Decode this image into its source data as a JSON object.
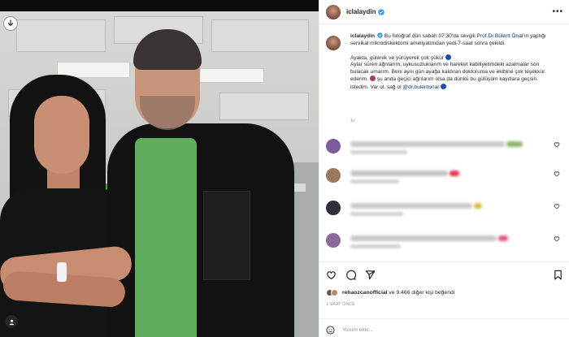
{
  "post": {
    "username": "iclalaydin",
    "more_label": "•••"
  },
  "caption": {
    "username": "iclalaydin",
    "line1": " Bu fotoğraf dün sabah 07:30'da sevgili ",
    "link1": "Prof.Dr.Bülent Önal",
    "line2": "'ın yaptığı servikal mikrodiskektomi ameliyatımdan yedi-7-saat sonra çekildi.",
    "line3": "Ayakta, gülerek ve yürüyerek çok şükür",
    "line4": "Aylar süren ağrılarım, uykusuzluklarım ve hareket kabiliyetimdeki azalmalar son bulacak umarım. Beni aynı gün ayağa kaldıran doktoruma ve ekibine çok teşekkür ederim.",
    "line5": " şu anda geçici ağrılarım olsa da dünkü bu gülüşüm kayıtlara geçsin istedim. Var ol, sağ ol ",
    "link2": "@dr.bulentonal",
    "time": "1s"
  },
  "comments": [
    {
      "avatar_color": "#7b5aa0",
      "blur_color": "#c9c9c9",
      "emoji_color": "#8bb86a"
    },
    {
      "avatar_color": "#9a7a5a",
      "blur_color": "#c6c6c6",
      "emoji_color": "#e0384f"
    },
    {
      "avatar_color": "#2f2f3a",
      "blur_color": "#cbcbcb",
      "emoji_color": "#e0c040"
    },
    {
      "avatar_color": "#8d6a9c",
      "blur_color": "#c8c8c8",
      "emoji_color": "#e05a8a"
    }
  ],
  "likes": {
    "first_user": "rehaozcanofficial",
    "rest": " ve 9.466 diğer kişi beğendi"
  },
  "posted": "1 SAAT ÖNCE",
  "add_comment": {
    "placeholder": "Yorum ekle..."
  },
  "icons": [
    "download-icon",
    "tag-user-icon",
    "more-icon",
    "verified-icon",
    "heart-icon",
    "comment-icon",
    "share-icon",
    "bookmark-icon",
    "emoji-icon"
  ],
  "colors": {
    "link": "#00376b",
    "verified": "#3897f0",
    "text": "#262626",
    "muted": "#8e8e8e"
  }
}
